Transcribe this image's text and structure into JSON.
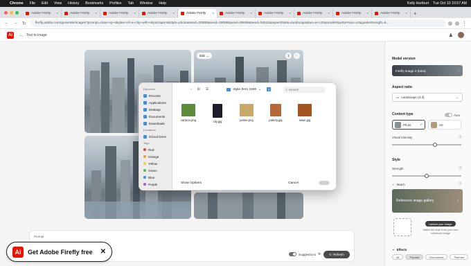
{
  "menubar": {
    "items": [
      "Chrome",
      "File",
      "Edit",
      "View",
      "History",
      "Bookmarks",
      "Profiles",
      "Tab",
      "Window",
      "Help"
    ],
    "user": "Kelly Hurlburt",
    "clock": "Tue Oct 10  10:57 AM"
  },
  "tabs": [
    {
      "label": "Adobe Firefly"
    },
    {
      "label": "Adobe Firefly"
    },
    {
      "label": "Adobe Firefly"
    },
    {
      "label": "Adobe Firefly"
    },
    {
      "label": "Adobe Firefly"
    },
    {
      "label": "Adobe Firefly"
    },
    {
      "label": "Adobe Firefly"
    },
    {
      "label": "Adobe Firefly"
    },
    {
      "label": "Adobe Firefly"
    },
    {
      "label": "Adobe Firefly"
    }
  ],
  "address": {
    "url": "firefly.adobe.com/generate/images?prompt=close-up+skyline+of+a+city+with+skyscrapers&style=photo&seed=33868&seed=29088&seed=89898&seed=34042&aspectRatio=landscape&lan=en-US&modelInputVersion=v2&guideStrength=6..."
  },
  "appbar": {
    "logo": "Ai",
    "crumb": "Text to image"
  },
  "image_actions": {
    "edit_label": "Edit"
  },
  "prompt": {
    "label": "Prompt",
    "suggestions_label": "Suggestions",
    "refresh_label": "Refresh"
  },
  "banner": {
    "logo": "Ai",
    "text": "Get Adobe Firefly free",
    "close": "✕"
  },
  "panel": {
    "model_version_title": "Model version",
    "model_value": "Firefly Image 2 (beta)",
    "aspect_title": "Aspect ratio",
    "aspect_value": "Landscape (4:3)",
    "content_type_title": "Content type",
    "auto_label": "Auto",
    "photo_label": "Photo",
    "art_label": "Art",
    "visual_intensity_label": "Visual intensity",
    "visual_intensity_value": 0.62,
    "style_title": "Style",
    "strength_label": "Strength",
    "strength_value": 0.5,
    "match_label": "Match",
    "reference_gallery_label": "Reference image gallery",
    "upload_label": "Upload your image",
    "upload_hint": "Match the style from your own reference image",
    "effects_title": "Effects",
    "chips": [
      "All",
      "Popular",
      "Documents",
      "Themes"
    ]
  },
  "dialog": {
    "favorites_title": "Favorites",
    "favorites": [
      "Recents",
      "Applications",
      "Desktop",
      "Documents",
      "Downloads"
    ],
    "locations_title": "Locations",
    "locations": [
      "iCloud Drive"
    ],
    "tags_title": "Tags",
    "tags": [
      {
        "label": "Red",
        "color": "#e0443e"
      },
      {
        "label": "Orange",
        "color": "#f39a2b"
      },
      {
        "label": "Yellow",
        "color": "#f5cf3c"
      },
      {
        "label": "Green",
        "color": "#52b848"
      },
      {
        "label": "Blue",
        "color": "#3a8ee6"
      },
      {
        "label": "Purple",
        "color": "#a15bd1"
      }
    ],
    "folder": "Style Zero 1920",
    "search_placeholder": "Search",
    "files": [
      {
        "name": "cartoon.png",
        "color": "#5c8c3a"
      },
      {
        "name": "city.jpg",
        "color": "#1c1c2a"
      },
      {
        "name": "poster.png",
        "color": "#c7a86a"
      },
      {
        "name": "pottery.jpg",
        "color": "#b5693a"
      },
      {
        "name": "swan.jpg",
        "color": "#a5551f"
      }
    ],
    "show_options": "Show Options",
    "cancel": "Cancel"
  }
}
